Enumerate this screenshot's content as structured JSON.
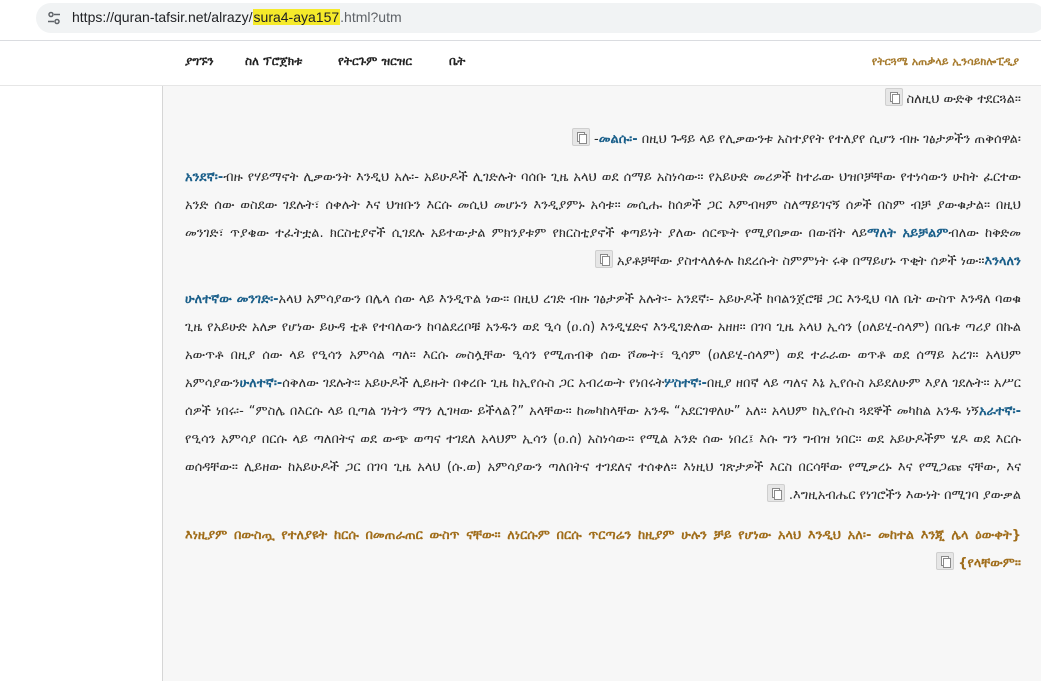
{
  "browser": {
    "url_prefix": "https://quran-tafsir.net/alrazy/",
    "url_highlight": "sura4-aya157",
    "url_suffix": ".html?utm"
  },
  "nav": {
    "items": [
      "ቤት",
      "የትርጉም ዝርዝር",
      "ስለ ፕሮጀክቱ",
      "ያግኙን"
    ],
    "brand": "የትርጓሜ አጠቃላይ ኢንሳይክሎፒዲያ"
  },
  "paragraphs": [
    {
      "type": "normal",
      "parts": [
        {
          "text": "ስለዚህ ውድቅ ተደርጓል።"
        }
      ]
    },
    {
      "type": "normal",
      "parts": [
        {
          "text": "መልሱ፡-",
          "style": "blue"
        },
        {
          "text": " በዚህ ጉዳይ ላይ የሊቃውንቱ አስተያየት የተለያየ ሲሆን ብዙ ገፅታዎችን ጠቅሰዋል፡-"
        }
      ]
    },
    {
      "type": "normal",
      "parts": [
        {
          "text": "አንደኛ፡-",
          "style": "blue"
        },
        {
          "text": "ብዙ የሃይማኖት ሊቃውንት እንዲህ አሉ፡- አይሁዶች ሊገድሉት ባሰቡ ጊዜ አላህ ወደ ሰማይ አስነሳው። የአይሁድ መሪዎች ከተራው ህዝቦቻቸው የተነሳውን ሁከት ፈርተው አንድ ሰው ወስደው ገደሉት፣ ሰቀሉት እና ህዝቡን እርሱ መሲህ መሆኑን እንዲያምኑ አሳቱ። መሲሑ ከሰዎች ጋር እምብዛም ስለማይገናኝ ሰዎች በስም ብቻ ያውቁታል። በዚህ መንገድ፣ ጥያቄው ተፈትቷል. ክርስቲያኖች ሲገደሉ አይተውታል ምክንያቱም የክርስቲያኖች ቀጣይነት ያለው ሰርጭት የሚያበቃው በውሸት ላይ"
        },
        {
          "text": "ማለት አይቻልም",
          "style": "blue"
        },
        {
          "text": "ብለው ከቅድመ አያቶቻቸው ያስተላለፉሉ ከደረሱት ስምምነት ሩቅ በማይሆኑ ጥቂት ሰዎች ነው።"
        },
        {
          "text": "እንላለን",
          "style": "blue"
        }
      ]
    },
    {
      "type": "normal",
      "parts": [
        {
          "text": "ሁለተኛው መንገድ፡-",
          "style": "blue"
        },
        {
          "text": "አላህ አምሳያውን በሌላ ሰው ላይ እንዲጥል ነው። በዚህ ረገድ ብዙ ገፅታዎች አሉት፡- አንደኛ፡- አይሁዶች ከባልንጀሮቹ ጋር እንዲህ ባለ ቤት ውስጥ እንዳለ ባወቁ ጊዜ የአይሁድ አለቃ የሆነው ይሁዳ ቲቶ የተባለውን ከባልደረቦቹ አንዱን ወደ ዒሳ (ዐ.ሰ) እንዲሄድና እንዲገድለው አዘዘ። በገባ ጊዜ አላህ ኢሳን (ዐለይሂ-ሰላም) በቤቱ ጣሪያ በኩል አውጥቶ በዚያ ሰው ላይ የዒሳን አምሳል ጣለ። እርሱ መስሏቸው ዒሳን የሚጠብቅ ሰው ሾሙት፣ ዒሳም (ዐለይሂ-ሰላም) ወደ ተራራው ወጥቶ ወደ ሰማይ አረገ። አላህም አምሳያውን"
        },
        {
          "text": "ሁለተኛ፡-",
          "style": "blue"
        },
        {
          "text": "ሰቅለው ገደሉት። አይሁዶች ሊይዙት በቀረቡ ጊዜ ከኢየሱስ ጋር አብረውት የነበሩት"
        },
        {
          "text": "ሦስተኛ፡-",
          "style": "blue"
        },
        {
          "text": "በዚያ ዘበኛ ላይ ጣለና እኔ ኢየሱስ አይደለሁም እያለ ገደሉት። አሥር ሰዎች ነበሩ፡- “ምስሌ በእርሱ ላይ ቢጣል ገነትን ማን ሊገዛው ይችላል?” አላቸው። ከመካከላቸው አንዱ “አደርገዋለሁ” አለ። አላህም ከኢየሱስ ጓደኞች መካከል አንዱ ነኝ"
        },
        {
          "text": "አራተኛ፡-",
          "style": "blue"
        },
        {
          "text": "የዒሳን አምሳያ በርሱ ላይ ጣለበትና ወደ ውጭ ወጣና ተገደለ አላህም ኢሳን (ዐ.ሰ) አስነሳው። የሚል አንድ ሰው ነበረ፤ እሱ ግን ግብዝ ነበር። ወደ አይሁዶችም ሄዶ ወደ እርሱ ወሰዳቸው። ሊይዘው ከአይሁዶች ጋር በገባ ጊዜ አላህ (ሱ.ወ) አምሳያውን ጣለበትና ተገደለና ተሰቀለ። እነዚህ ገጽታዎች እርስ በርሳቸው የሚቃረኑ እና የሚጋጩ ናቸው, እና እግዚአብሔር የነገሮችን እውነት በሚገባ ያውቃል."
        }
      ]
    },
    {
      "type": "quote",
      "parts": [
        {
          "text": "{እነዚያም በውስጧ የተለያዩት ከርሱ በመጠራጠር ውስጥ ናቸው። ለነርሱም በርሱ ጥርጣሬን ከዚያም ሁሉን ቻይ የሆነው አላህ እንዲህ አለ፡- መከተል እንጂ ሌላ ዕውቀት የላቸውም።}"
        }
      ]
    }
  ]
}
